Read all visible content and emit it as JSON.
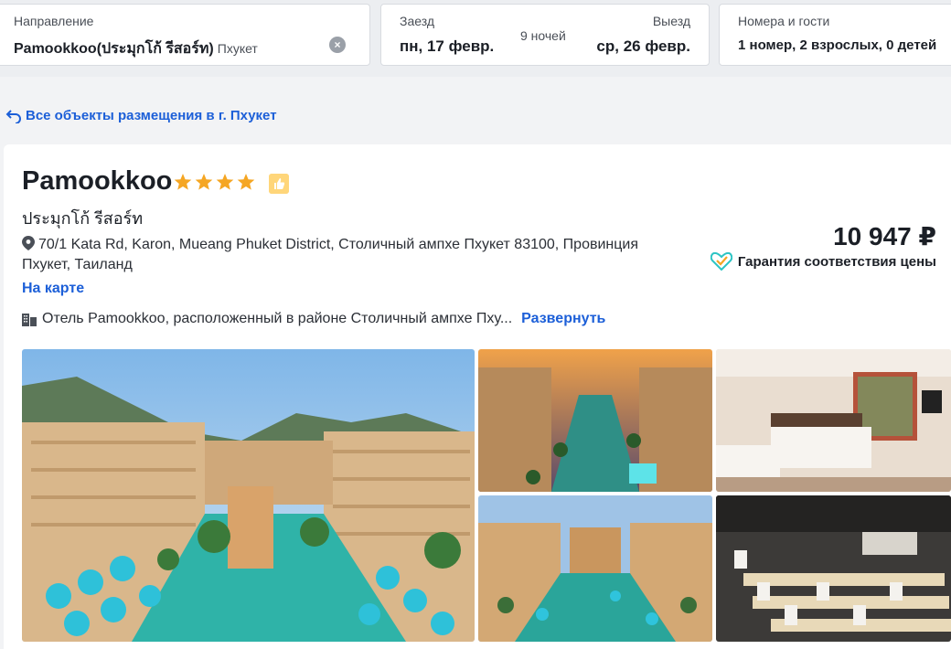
{
  "search": {
    "destination_label": "Направление",
    "destination_value": "Pamookkoo(ประมุกโก้ รีสอร์ท)",
    "destination_city": "Пхукет",
    "checkin_label": "Заезд",
    "checkin_value": "пн, 17 февр.",
    "nights": "9 ночей",
    "checkout_label": "Выезд",
    "checkout_value": "ср, 26 февр.",
    "guests_label": "Номера и гости",
    "guests_value": "1 номер, 2 взрослых, 0 детей"
  },
  "back_link": "Все объекты размещения в г. Пхукет",
  "hotel": {
    "name": "Pamookkoo",
    "stars": 4,
    "local_name": "ประมุกโก้ รีสอร์ท",
    "address": "70/1 Kata Rd, Karon, Mueang Phuket District, Столичный ампхе Пхукет 83100, Провинция Пхукет, Таиланд",
    "map_link": "На карте",
    "description": "Отель Pamookkoo, расположенный в районе Столичный ампхе Пху...",
    "expand_link": "Развернуть",
    "price": "10 947 ₽",
    "guarantee": "Гарантия соответствия цены"
  },
  "colors": {
    "accent": "#1c5fd8",
    "star": "#f5a623",
    "guarantee_teal": "#2cc4c4"
  },
  "icons": {
    "clear": "clear-icon",
    "back": "back-arrow-icon",
    "pin": "map-pin-icon",
    "building": "building-icon",
    "guarantee": "heart-check-icon",
    "thumb": "thumbs-up-badge-icon"
  }
}
